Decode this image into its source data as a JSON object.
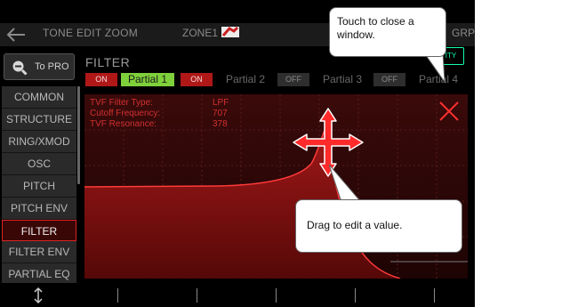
{
  "header": {
    "title": "TONE EDIT ZOOM",
    "zone": "ZONE1",
    "grp": "GRP"
  },
  "to_pro_label": "To PRO",
  "sidebar": {
    "items": [
      {
        "label": "COMMON"
      },
      {
        "label": "STRUCTURE"
      },
      {
        "label": "RING/XMOD"
      },
      {
        "label": "OSC"
      },
      {
        "label": "PITCH"
      },
      {
        "label": "PITCH ENV"
      },
      {
        "label": "FILTER",
        "selected": true
      },
      {
        "label": "FILTER ENV"
      },
      {
        "label": "PARTIAL EQ"
      }
    ]
  },
  "section_title": "FILTER",
  "ity_button_label": "ITY",
  "partials": [
    {
      "switch": "ON",
      "label": "Partial 1",
      "active": true
    },
    {
      "switch": "ON",
      "label": "Partial 2",
      "active": false
    },
    {
      "switch": "OFF",
      "label": "Partial 3",
      "active": false
    },
    {
      "switch": "OFF",
      "label": "Partial 4",
      "active": false
    }
  ],
  "params": [
    {
      "name": "TVF Filter Type:",
      "value": "LPF"
    },
    {
      "name": "Cutoff Frequency:",
      "value": "707"
    },
    {
      "name": "TVF Resonance:",
      "value": "378"
    }
  ],
  "callouts": {
    "close": "Touch to close a window.",
    "drag": "Drag to edit a value."
  },
  "colors": {
    "accent_red": "#d22222",
    "active_green": "#7fd13b",
    "on_red": "#b01818"
  }
}
